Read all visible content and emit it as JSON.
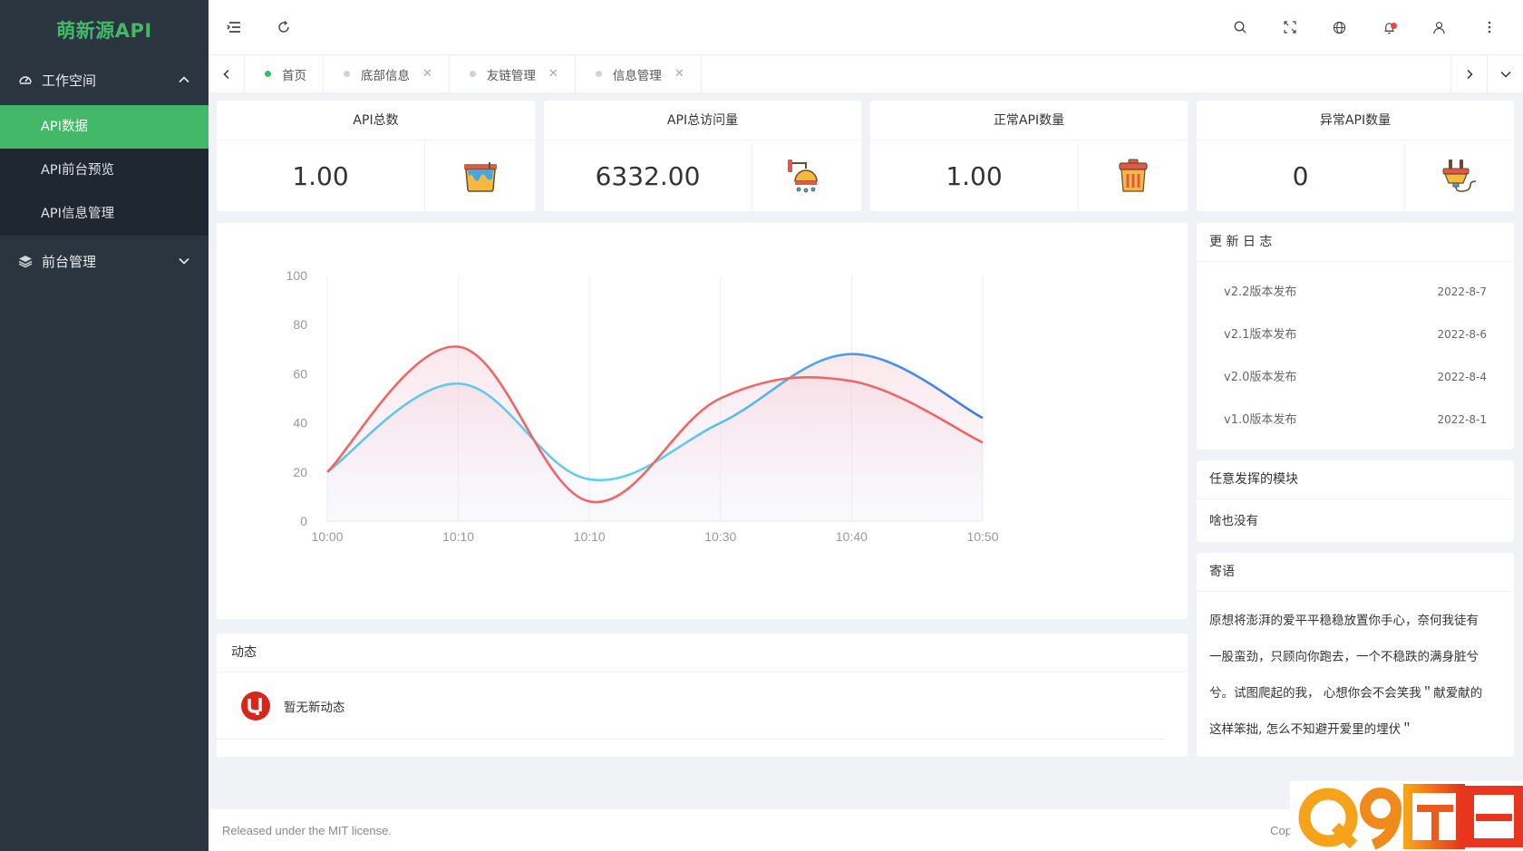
{
  "app": {
    "title": "萌新源API"
  },
  "sidebar": {
    "workspace": {
      "label": "工作空间",
      "items": [
        {
          "label": "API数据",
          "active": true
        },
        {
          "label": "API前台预览",
          "active": false
        },
        {
          "label": "API信息管理",
          "active": false
        }
      ]
    },
    "frontend": {
      "label": "前台管理"
    }
  },
  "tabs": [
    {
      "label": "首页",
      "active": true,
      "closable": false
    },
    {
      "label": "底部信息",
      "active": false,
      "closable": true
    },
    {
      "label": "友链管理",
      "active": false,
      "closable": true
    },
    {
      "label": "信息管理",
      "active": false,
      "closable": true
    }
  ],
  "stats": [
    {
      "title": "API总数",
      "value": "1.00",
      "icon": "paint-bucket-icon"
    },
    {
      "title": "API总访问量",
      "value": "6332.00",
      "icon": "shower-icon"
    },
    {
      "title": "正常API数量",
      "value": "1.00",
      "icon": "trash-can-icon"
    },
    {
      "title": "异常API数量",
      "value": "0",
      "icon": "plug-icon"
    }
  ],
  "changelog": {
    "title": "更 新 日 志",
    "items": [
      {
        "label": "v2.2版本发布",
        "date": "2022-8-7"
      },
      {
        "label": "v2.1版本发布",
        "date": "2022-8-6"
      },
      {
        "label": "v2.0版本发布",
        "date": "2022-8-4"
      },
      {
        "label": "v1.0版本发布",
        "date": "2022-8-1"
      }
    ]
  },
  "module": {
    "title": "任意发挥的模块",
    "text": "啥也没有"
  },
  "message": {
    "title": "寄语",
    "lines": [
      "原想将澎湃的爱平平稳稳放置你手心，奈何我徒有",
      "一股蛮劲，只顾向你跑去，一个不稳跌的满身脏兮",
      "兮。试图爬起的我， 心想你会不会笑我＂献爱献的",
      "这样笨拙, 怎么不知避开爱里的埋伏＂"
    ]
  },
  "activity": {
    "title": "动态",
    "empty_text": "暂无新动态"
  },
  "footer": {
    "left": "Released under the MIT license.",
    "right": "Cop"
  },
  "chart_data": {
    "type": "line",
    "categories": [
      "10:00",
      "10:10",
      "10:10",
      "10:30",
      "10:40",
      "10:50"
    ],
    "series": [
      {
        "values": [
          20,
          56,
          17,
          40,
          68,
          42
        ],
        "color": "#4a86e8"
      },
      {
        "values": [
          20,
          71,
          8,
          50,
          57,
          32
        ],
        "color": "#ee6666"
      }
    ],
    "ylim": [
      0,
      100
    ],
    "yticks": [
      "0",
      "20",
      "40",
      "60",
      "80",
      "100"
    ],
    "grid": "vertical"
  }
}
